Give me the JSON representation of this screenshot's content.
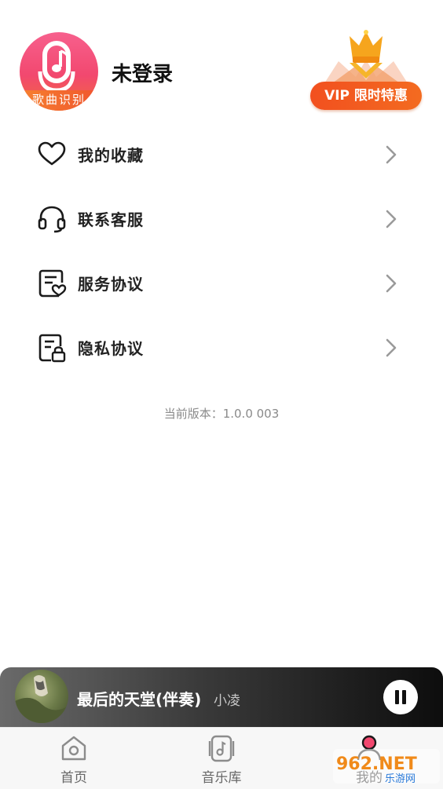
{
  "profile": {
    "logo_text": "歌曲识别",
    "login_status": "未登录",
    "vip_label": "VIP 限时特惠"
  },
  "menu": {
    "items": [
      {
        "label": "我的收藏",
        "icon": "heart-icon"
      },
      {
        "label": "联系客服",
        "icon": "headset-icon"
      },
      {
        "label": "服务协议",
        "icon": "document-heart-icon"
      },
      {
        "label": "隐私协议",
        "icon": "document-lock-icon"
      }
    ]
  },
  "version_text": "当前版本：1.0.0 003",
  "player": {
    "title": "最后的天堂(伴奏)",
    "artist": "小凌",
    "state": "playing"
  },
  "tabs": [
    {
      "label": "首页",
      "icon": "home-icon"
    },
    {
      "label": "音乐库",
      "icon": "music-library-icon"
    },
    {
      "label": "我的",
      "icon": "profile-icon",
      "active": true
    }
  ],
  "watermark": {
    "text": "962.NET",
    "sub": "乐游网"
  },
  "colors": {
    "accent": "#f2486f",
    "vip_orange": "#f2501f",
    "background": "#ffffff"
  }
}
